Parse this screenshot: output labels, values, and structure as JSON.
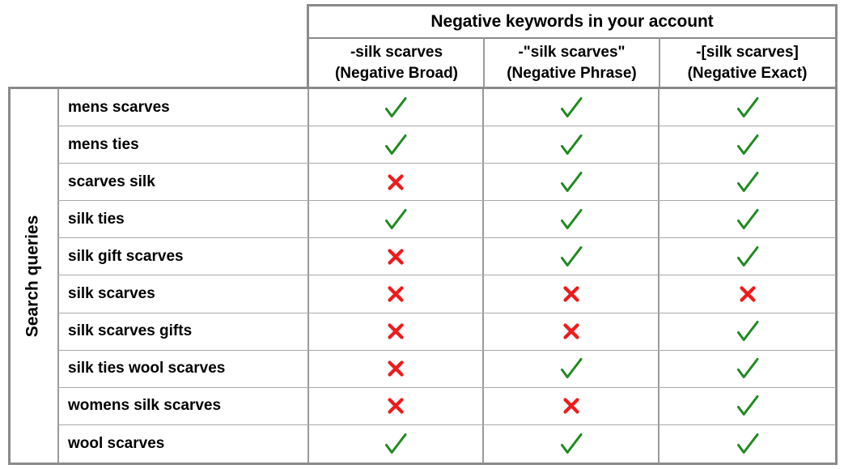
{
  "table": {
    "row_axis_label": "Search queries",
    "column_group_title": "Negative keywords in your account",
    "columns": [
      {
        "keyword": "-silk scarves",
        "match_type": "(Negative Broad)"
      },
      {
        "keyword": "-\"silk scarves\"",
        "match_type": "(Negative Phrase)"
      },
      {
        "keyword": "-[silk scarves]",
        "match_type": "(Negative Exact)"
      }
    ],
    "rows": [
      {
        "query": "mens scarves",
        "marks": [
          "check",
          "check",
          "check"
        ]
      },
      {
        "query": "mens ties",
        "marks": [
          "check",
          "check",
          "check"
        ]
      },
      {
        "query": "scarves silk",
        "marks": [
          "cross",
          "check",
          "check"
        ]
      },
      {
        "query": "silk ties",
        "marks": [
          "check",
          "check",
          "check"
        ]
      },
      {
        "query": "silk gift scarves",
        "marks": [
          "cross",
          "check",
          "check"
        ]
      },
      {
        "query": "silk scarves",
        "marks": [
          "cross",
          "cross",
          "cross"
        ]
      },
      {
        "query": "silk scarves gifts",
        "marks": [
          "cross",
          "cross",
          "check"
        ]
      },
      {
        "query": "silk ties wool scarves",
        "marks": [
          "cross",
          "check",
          "check"
        ]
      },
      {
        "query": "womens silk scarves",
        "marks": [
          "cross",
          "cross",
          "check"
        ]
      },
      {
        "query": "wool scarves",
        "marks": [
          "check",
          "check",
          "check"
        ]
      }
    ],
    "mark_names": {
      "check": "green-check-icon",
      "cross": "red-cross-icon"
    },
    "colors": {
      "check": "#1f8a1f",
      "cross": "#ee1b1b",
      "outer_border": "#8a8a8a",
      "inner_border": "#9a9a9a",
      "row_divider": "#a9a9a9",
      "text": "#000000",
      "background": "#ffffff"
    }
  }
}
